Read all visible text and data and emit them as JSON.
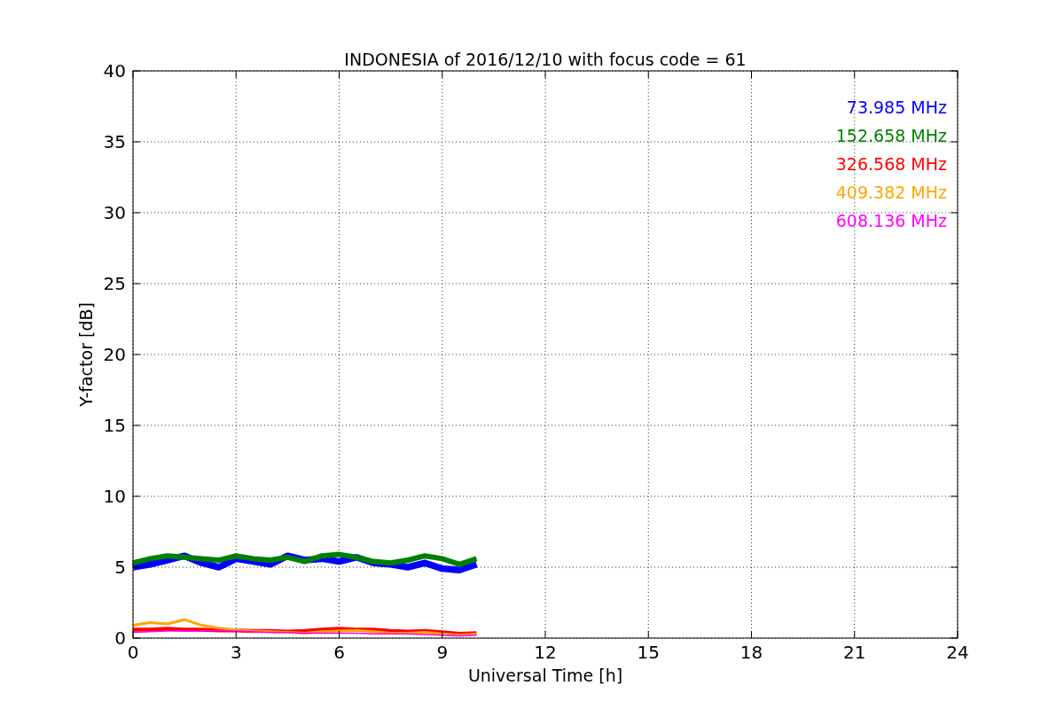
{
  "figure": {
    "chart_data": {
      "type": "line",
      "title": "INDONESIA of 2016/12/10 with focus code = 61",
      "xlabel": "Universal Time [h]",
      "ylabel": "Y-factor [dB]",
      "x": [
        0,
        0.5,
        1,
        1.5,
        2,
        2.5,
        3,
        3.5,
        4,
        4.5,
        5,
        5.5,
        6,
        6.5,
        7,
        7.5,
        8,
        8.5,
        9,
        9.5,
        10
      ],
      "series": [
        {
          "name": "73.985 MHz",
          "color": "#0000ff",
          "values": [
            5,
            5.2,
            5.5,
            5.8,
            5.3,
            5,
            5.6,
            5.4,
            5.2,
            5.8,
            5.5,
            5.6,
            5.4,
            5.7,
            5.3,
            5.2,
            5.0,
            5.3,
            4.9,
            4.8,
            5.2
          ]
        },
        {
          "name": "152.658 MHz",
          "color": "#008000",
          "values": [
            5.3,
            5.6,
            5.8,
            5.7,
            5.6,
            5.5,
            5.8,
            5.6,
            5.5,
            5.7,
            5.4,
            5.8,
            5.9,
            5.7,
            5.4,
            5.3,
            5.5,
            5.8,
            5.6,
            5.2,
            5.6
          ]
        },
        {
          "name": "326.568 MHz",
          "color": "#ff0000",
          "values": [
            0.6,
            0.6,
            0.65,
            0.6,
            0.6,
            0.55,
            0.55,
            0.5,
            0.5,
            0.45,
            0.5,
            0.6,
            0.65,
            0.6,
            0.6,
            0.5,
            0.45,
            0.5,
            0.4,
            0.3,
            0.35
          ]
        },
        {
          "name": "409.382 MHz",
          "color": "#ffa500",
          "values": [
            0.9,
            1.1,
            1.0,
            1.3,
            0.9,
            0.7,
            0.6,
            0.5,
            0.45,
            0.4,
            0.35,
            0.45,
            0.5,
            0.55,
            0.45,
            0.35,
            0.35,
            0.4,
            0.3,
            0.2,
            0.3
          ]
        },
        {
          "name": "608.136 MHz",
          "color": "#ff00ff",
          "values": [
            0.4,
            0.45,
            0.5,
            0.5,
            0.5,
            0.55,
            0.5,
            0.45,
            0.4,
            0.4,
            0.35,
            0.35,
            0.35,
            0.35,
            0.3,
            0.3,
            0.3,
            0.25,
            0.2,
            0.15,
            0.2
          ]
        }
      ],
      "xlim": [
        0,
        24
      ],
      "ylim": [
        0,
        40
      ],
      "xticks": [
        0,
        3,
        6,
        9,
        12,
        15,
        18,
        21,
        24
      ],
      "yticks": [
        0,
        5,
        10,
        15,
        20,
        25,
        30,
        35,
        40
      ],
      "grid": true
    }
  }
}
